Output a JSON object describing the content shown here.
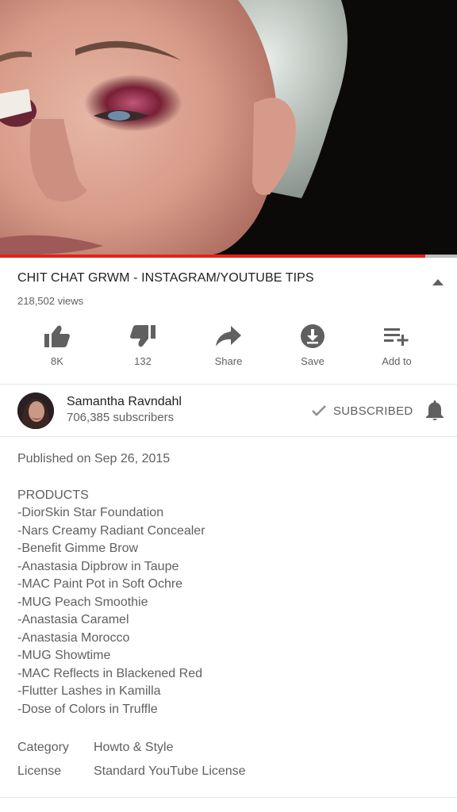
{
  "video": {
    "title": "CHIT CHAT GRWM - INSTAGRAM/YOUTUBE TIPS",
    "views": "218,502 views",
    "progress_fraction": 0.93
  },
  "actions": {
    "like": {
      "icon": "thumbs-up-icon",
      "label": "8K"
    },
    "dislike": {
      "icon": "thumbs-down-icon",
      "label": "132"
    },
    "share": {
      "icon": "share-icon",
      "label": "Share"
    },
    "save": {
      "icon": "download-icon",
      "label": "Save"
    },
    "add_to": {
      "icon": "playlist-add-icon",
      "label": "Add to"
    }
  },
  "channel": {
    "name": "Samantha Ravndahl",
    "subscribers": "706,385 subscribers",
    "subscribed_label": "SUBSCRIBED"
  },
  "description": {
    "published": "Published on Sep 26, 2015",
    "lines": [
      "PRODUCTS",
      "-DiorSkin Star Foundation",
      "-Nars Creamy Radiant Concealer",
      "-Benefit Gimme Brow",
      "-Anastasia Dipbrow in Taupe",
      "-MAC Paint Pot in Soft Ochre",
      "-MUG Peach Smoothie",
      "-Anastasia Caramel",
      "-Anastasia Morocco",
      "-MUG Showtime",
      "-MAC Reflects in Blackened Red",
      "-Flutter Lashes in Kamilla",
      "-Dose of Colors in Truffle"
    ]
  },
  "meta": {
    "category_label": "Category",
    "category_value": "Howto & Style",
    "license_label": "License",
    "license_value": "Standard YouTube License"
  },
  "colors": {
    "progress": "#e62117",
    "icon": "#606060",
    "text_primary": "#212121",
    "text_secondary": "#606060"
  }
}
